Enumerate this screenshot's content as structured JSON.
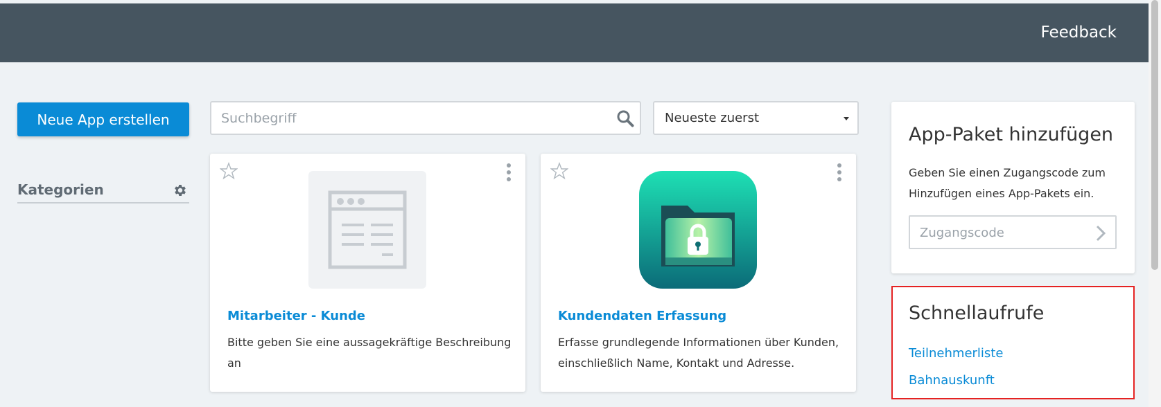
{
  "header": {
    "feedback_label": "Feedback"
  },
  "toolbar": {
    "new_app_label": "Neue App erstellen",
    "search_placeholder": "Suchbegriff",
    "sort_selected": "Neueste zuerst"
  },
  "sidebar": {
    "categories_label": "Kategorien"
  },
  "apps": [
    {
      "title": "Mitarbeiter - Kunde",
      "description": "Bitte geben Sie eine aussagekräftige Beschreibung an",
      "icon": "app-placeholder-icon"
    },
    {
      "title": "Kundendaten Erfassung",
      "description": "Erfasse grundlegende Informationen über Kunden, einschließlich Name, Kontakt und Adresse.",
      "icon": "secure-folder-icon"
    }
  ],
  "add_package": {
    "title": "App-Paket hinzufügen",
    "text": "Geben Sie einen Zugangscode zum Hinzufügen eines App-Pakets ein.",
    "code_placeholder": "Zugangscode"
  },
  "quick_links": {
    "title": "Schnellaufrufe",
    "links": [
      "Teilnehmerliste",
      "Bahnauskunft"
    ]
  },
  "colors": {
    "header_bg": "#465560",
    "accent": "#0a8bd6",
    "page_bg": "#eef2f5",
    "highlight_border": "#e52222"
  }
}
